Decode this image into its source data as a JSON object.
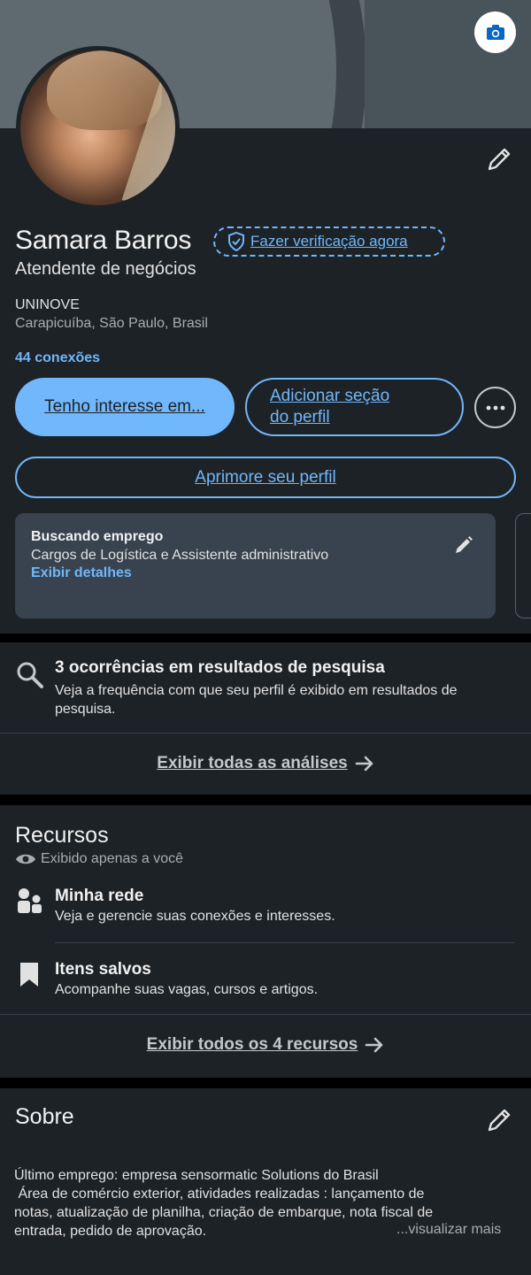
{
  "profile": {
    "name": "Samara Barros",
    "verify_label": "Fazer verificação agora",
    "headline": "Atendente de negócios",
    "school": "UNINOVE",
    "location": "Carapicuíba, São Paulo, Brasil",
    "connections": "44 conexões",
    "open_to_label": "Tenho interesse em...",
    "add_section_line1": "Adicionar seção",
    "add_section_line2": "do perfil",
    "enhance_label": "Aprimore seu perfil",
    "open_to_work": {
      "title": "Buscando emprego",
      "description": "Cargos de Logística e Assistente administrativo",
      "link": "Exibir detalhes"
    }
  },
  "analytics": {
    "title": "3 ocorrências em resultados de pesquisa",
    "description": "Veja a frequência com que seu perfil é exibido em resultados de pesquisa.",
    "show_all": "Exibir todas as análises"
  },
  "resources": {
    "title": "Recursos",
    "private_label": "Exibido apenas a você",
    "items": [
      {
        "title": "Minha rede",
        "description": "Veja e gerencie suas conexões e interesses.",
        "icon": "people-icon"
      },
      {
        "title": "Itens salvos",
        "description": "Acompanhe suas vagas, cursos e artigos.",
        "icon": "bookmark-icon"
      }
    ],
    "show_all": "Exibir todos os 4 recursos"
  },
  "about": {
    "title": "Sobre",
    "lines": [
      "Último emprego: empresa sensormatic Solutions do Brasil",
      " Área de comércio exterior, atividades realizadas : lançamento de",
      "notas, atualização de planilha, criação de embarque, nota fiscal de",
      "entrada, pedido de aprovação."
    ],
    "see_more": "...visualizar mais"
  },
  "colors": {
    "accent": "#71b7fb",
    "card_bg": "#1d2226",
    "page_bg": "#000000",
    "panel_bg": "#38434f"
  }
}
